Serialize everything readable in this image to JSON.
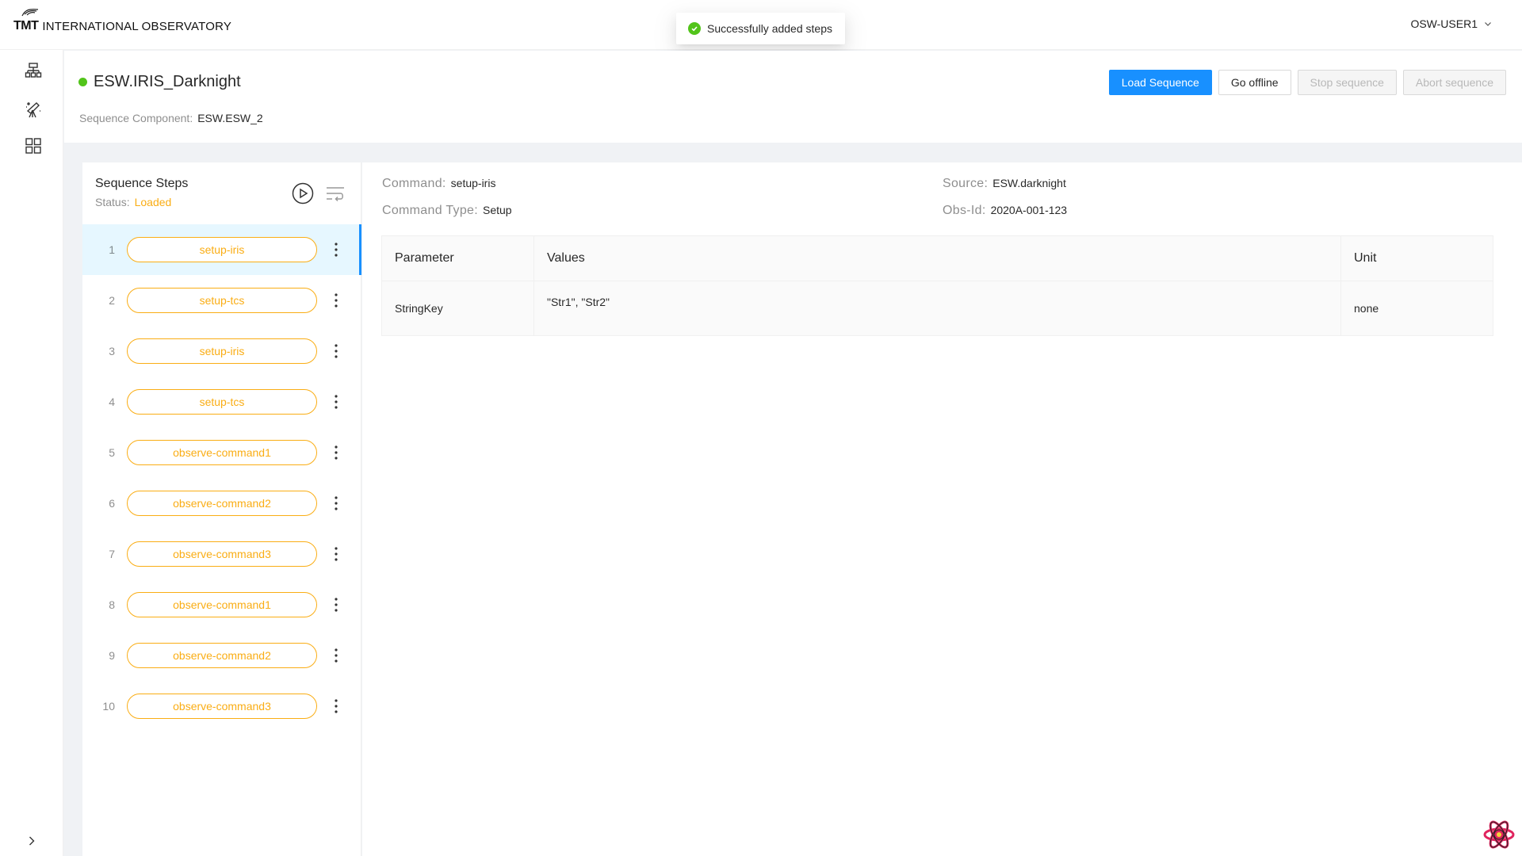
{
  "header": {
    "logo_mark": "TMT",
    "logo_text": "INTERNATIONAL OBSERVATORY",
    "user": "OSW-USER1"
  },
  "toast": {
    "message": "Successfully added steps"
  },
  "sider": {
    "items": [
      {
        "icon": "cluster-icon"
      },
      {
        "icon": "telescope-icon"
      },
      {
        "icon": "appstore-icon"
      }
    ]
  },
  "page": {
    "title": "ESW.IRIS_Darknight",
    "status_color": "#52c41a",
    "sequence_component_label": "Sequence Component:",
    "sequence_component_value": "ESW.ESW_2",
    "actions": {
      "load": "Load Sequence",
      "offline": "Go offline",
      "stop": "Stop sequence",
      "abort": "Abort sequence"
    }
  },
  "steps": {
    "title": "Sequence Steps",
    "status_label": "Status:",
    "status_value": "Loaded",
    "items": [
      {
        "num": "1",
        "label": "setup-iris"
      },
      {
        "num": "2",
        "label": "setup-tcs"
      },
      {
        "num": "3",
        "label": "setup-iris"
      },
      {
        "num": "4",
        "label": "setup-tcs"
      },
      {
        "num": "5",
        "label": "observe-command1"
      },
      {
        "num": "6",
        "label": "observe-command2"
      },
      {
        "num": "7",
        "label": "observe-command3"
      },
      {
        "num": "8",
        "label": "observe-command1"
      },
      {
        "num": "9",
        "label": "observe-command2"
      },
      {
        "num": "10",
        "label": "observe-command3"
      }
    ]
  },
  "details": {
    "command_label": "Command:",
    "command_value": "setup-iris",
    "command_type_label": "Command Type:",
    "command_type_value": "Setup",
    "source_label": "Source:",
    "source_value": "ESW.darknight",
    "obsid_label": "Obs-Id:",
    "obsid_value": "2020A-001-123",
    "table": {
      "headers": [
        "Parameter",
        "Values",
        "Unit"
      ],
      "rows": [
        {
          "parameter": "StringKey",
          "values": "\"Str1\", \"Str2\"",
          "unit": "none"
        }
      ]
    }
  },
  "colors": {
    "primary": "#1890ff",
    "warning": "#faad14",
    "success": "#52c41a"
  }
}
